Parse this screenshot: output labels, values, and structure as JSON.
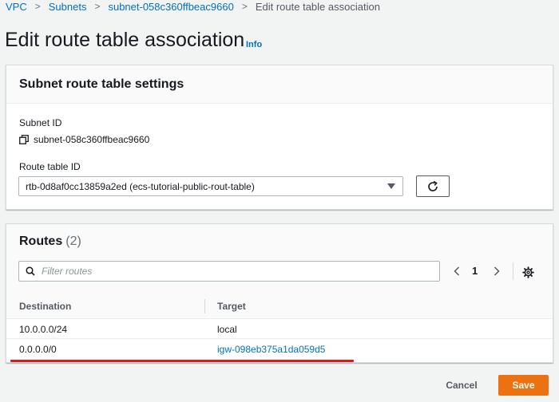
{
  "breadcrumb": {
    "items": [
      "VPC",
      "Subnets",
      "subnet-058c360ffbeac9660"
    ],
    "current": "Edit route table association"
  },
  "page": {
    "title": "Edit route table association",
    "info": "Info"
  },
  "settings": {
    "title": "Subnet route table settings",
    "subnet_label": "Subnet ID",
    "subnet_value": "subnet-058c360ffbeac9660",
    "route_table_label": "Route table ID",
    "route_table_selected": "rtb-0d8af0cc13859a2ed (ecs-tutorial-public-rout-table)"
  },
  "routes": {
    "title": "Routes",
    "count": "(2)",
    "filter_placeholder": "Filter routes",
    "page": "1",
    "columns": [
      "Destination",
      "Target"
    ],
    "rows": [
      {
        "destination": "10.0.0.0/24",
        "target": "local"
      },
      {
        "destination": "0.0.0.0/0",
        "target": "igw-098eb375a1da059d5"
      }
    ]
  },
  "actions": {
    "cancel": "Cancel",
    "save": "Save"
  },
  "colors": {
    "primary_button": "#ec7211",
    "link": "#0073bb",
    "highlight": "#e4141b"
  }
}
